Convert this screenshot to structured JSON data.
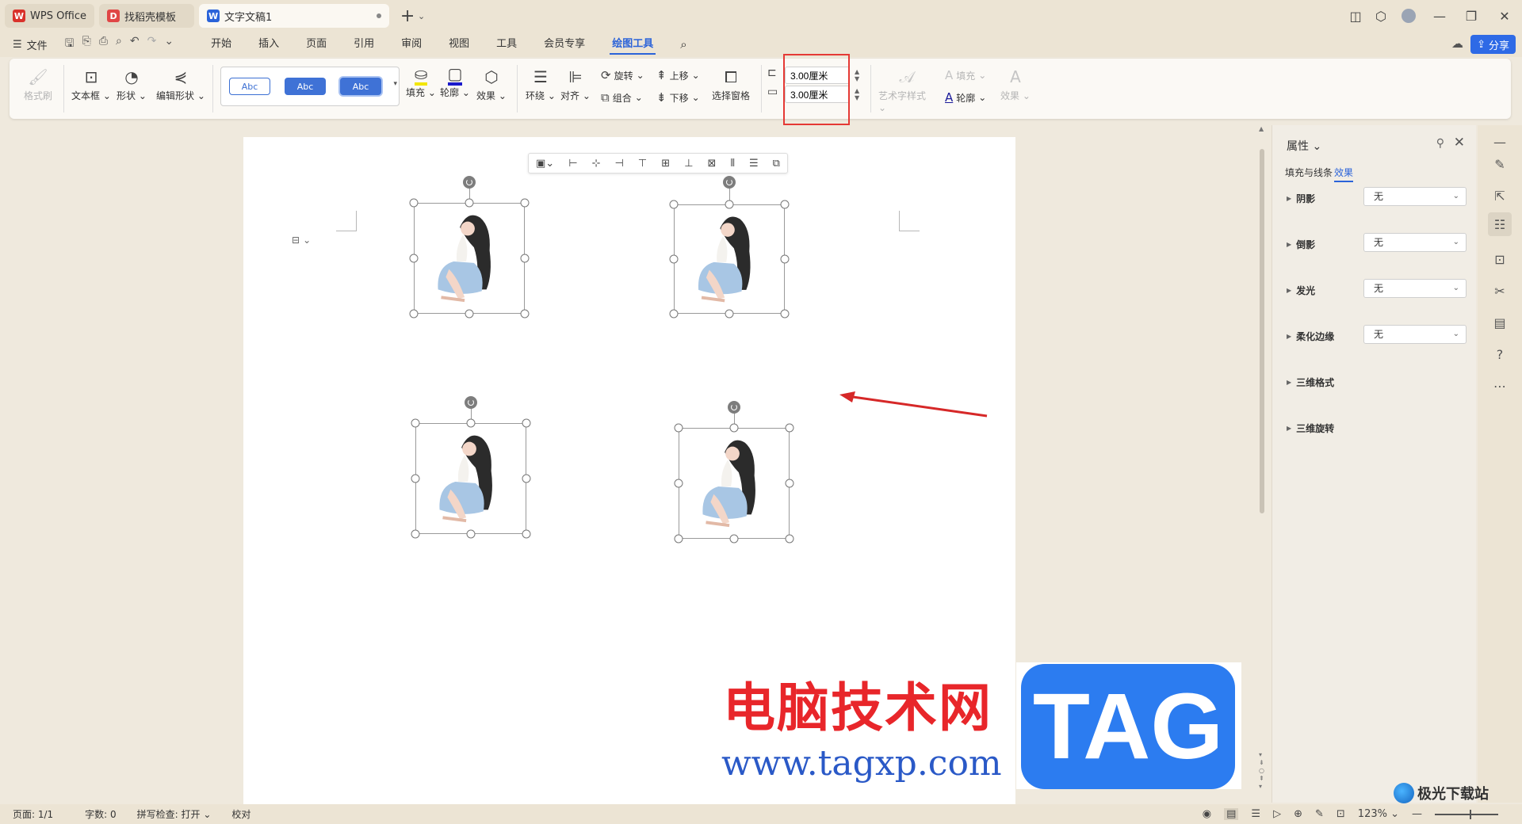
{
  "tabs": [
    {
      "label": "WPS Office",
      "icon": "wps-logo-icon",
      "color": "#d9322b"
    },
    {
      "label": "找稻壳模板",
      "icon": "docer-logo-icon",
      "color": "#e04646"
    },
    {
      "label": "文字文稿1",
      "icon": "word-doc-icon",
      "color": "#2b63d9"
    }
  ],
  "menu": {
    "file_label": "文件",
    "tabs": [
      "开始",
      "插入",
      "页面",
      "引用",
      "审阅",
      "视图",
      "工具",
      "会员专享",
      "绘图工具"
    ],
    "active_tab": "绘图工具",
    "share_label": "分享"
  },
  "ribbon": {
    "format_painter": "格式刷",
    "textbox": "文本框",
    "shape": "形状",
    "edit_shape": "编辑形状",
    "style_samples": [
      "Abc",
      "Abc",
      "Abc"
    ],
    "fill": "填充",
    "outline": "轮廓",
    "effect": "效果",
    "wrap": "环绕",
    "align": "对齐",
    "rotate": "旋转",
    "group": "组合",
    "bring_forward": "上移",
    "send_backward": "下移",
    "selection_pane": "选择窗格",
    "height_value": "3.00厘米",
    "width_value": "3.00厘米",
    "art_text_style": "艺术字样式",
    "text_fill": "填充",
    "text_outline": "轮廓",
    "text_effect": "效果"
  },
  "panel": {
    "title": "属性",
    "tab_fill_line": "填充与线条",
    "tab_effect": "效果",
    "properties": [
      {
        "label": "阴影",
        "value": "无"
      },
      {
        "label": "倒影",
        "value": "无"
      },
      {
        "label": "发光",
        "value": "无"
      },
      {
        "label": "柔化边缘",
        "value": "无"
      },
      {
        "label": "三维格式",
        "value": null
      },
      {
        "label": "三维旋转",
        "value": null
      }
    ]
  },
  "watermark": {
    "cn_text": "电脑技术网",
    "url": "www.tagxp.com",
    "tag": "TAG",
    "corner_text": "极光下载站"
  },
  "statusbar": {
    "page": "页面: 1/1",
    "words": "字数: 0",
    "spell": "拼写检查: 打开",
    "proof": "校对",
    "zoom": "123%"
  },
  "colors": {
    "accent": "#2b63d9",
    "highlight_box": "#e53935",
    "arrow": "#d62828"
  }
}
